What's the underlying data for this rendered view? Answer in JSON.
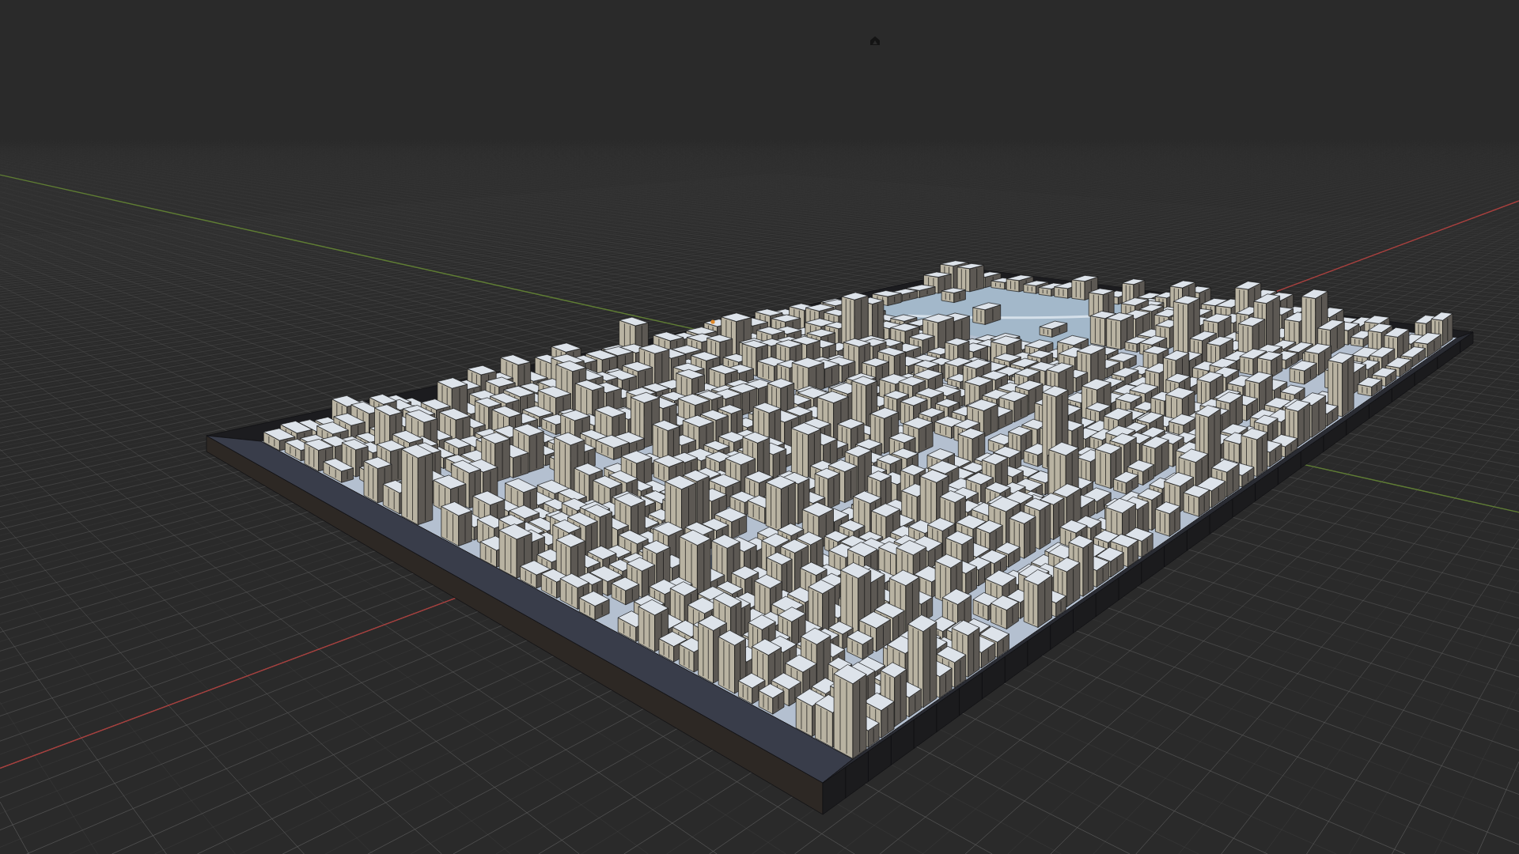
{
  "viewport": {
    "grid": true,
    "axes": [
      {
        "kind": "x",
        "color": "#a8403e"
      },
      {
        "kind": "y",
        "color": "#5f7d33"
      }
    ],
    "objects": [
      {
        "kind": "base"
      },
      {
        "kind": "city"
      },
      {
        "kind": "light"
      },
      {
        "kind": "origin"
      }
    ]
  }
}
